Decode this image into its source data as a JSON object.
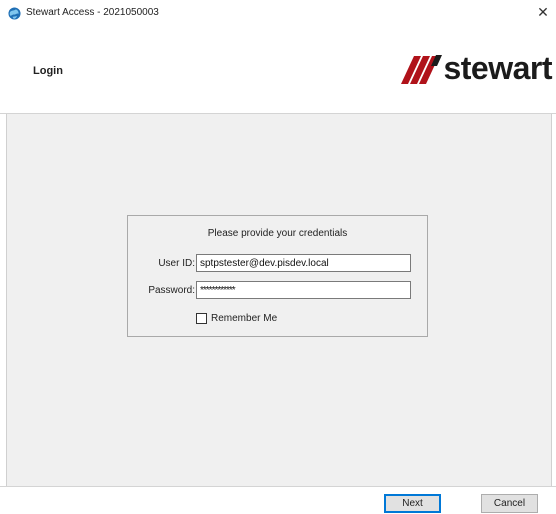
{
  "window": {
    "title": "Stewart Access - 2021050003",
    "close_glyph": "✕",
    "icon": "app-globe-icon"
  },
  "header": {
    "title": "Login",
    "logo_text": "stewart",
    "logo_mark": "stewart-slashes-logo",
    "brand_color": "#b0121a"
  },
  "login": {
    "prompt": "Please provide your credentials",
    "user_id_label": "User ID:",
    "user_id_value": "sptpstester@dev.pisdev.local",
    "password_label": "Password:",
    "password_value": "************",
    "remember_label": "Remember Me",
    "remember_checked": false
  },
  "footer": {
    "next_label": "Next",
    "cancel_label": "Cancel"
  },
  "colors": {
    "panel_bg": "#f0f0f0",
    "focus_border": "#0078d7"
  }
}
